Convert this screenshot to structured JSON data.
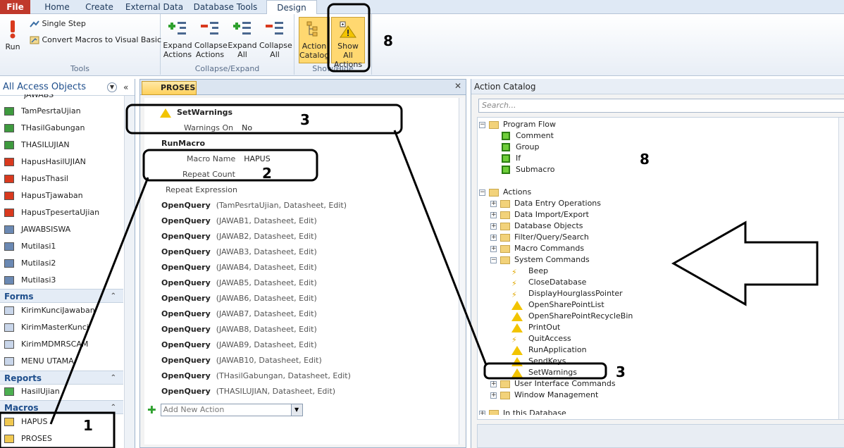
{
  "tabs": [
    "File",
    "Home",
    "Create",
    "External Data",
    "Database Tools",
    "Design"
  ],
  "ribbon": {
    "run": "Run",
    "single_step": "Single Step",
    "convert": "Convert Macros to Visual Basic",
    "tools_label": "Tools",
    "expand_actions": [
      "Expand",
      "Actions"
    ],
    "collapse_actions": [
      "Collapse",
      "Actions"
    ],
    "expand_all": [
      "Expand",
      "All"
    ],
    "collapse_all": [
      "Collapse",
      "All"
    ],
    "collapse_expand_label": "Collapse/Expand",
    "action_catalog": [
      "Action",
      "Catalog"
    ],
    "show_all_actions": [
      "Show All",
      "Actions"
    ],
    "show_hide_label": "Show/Hide"
  },
  "nav": {
    "title": "All Access Objects",
    "top_cut": "JAWABS",
    "queries": [
      "TamPesrtaUjian",
      "THasilGabungan",
      "THASILUJIAN",
      "HapusHasilUJIAN",
      "HapusThasil",
      "HapusTjawaban",
      "HapusTpesertaUjian",
      "JAWABSISWA",
      "Mutilasi1",
      "Mutilasi2",
      "Mutilasi3"
    ],
    "forms_label": "Forms",
    "forms": [
      "KirimKunciJawaban",
      "KirimMasterKunci",
      "KirimMDMRSCAM",
      "MENU UTAMA"
    ],
    "reports_label": "Reports",
    "reports": [
      "HasilUjian"
    ],
    "macros_label": "Macros",
    "macros": [
      "HAPUS",
      "PROSES"
    ]
  },
  "macro": {
    "tab": "PROSES",
    "setwarnings": "SetWarnings",
    "warnings_on_label": "Warnings On",
    "warnings_on_value": "No",
    "runmacro": "RunMacro",
    "macro_name_label": "Macro Name",
    "macro_name_value": "HAPUS",
    "repeat_count_label": "Repeat Count",
    "repeat_expression_label": "Repeat Expression",
    "openquery_label": "OpenQuery",
    "openqueries": [
      "(TamPesrtaUjian, Datasheet, Edit)",
      "(JAWAB1, Datasheet, Edit)",
      "(JAWAB2, Datasheet, Edit)",
      "(JAWAB3, Datasheet, Edit)",
      "(JAWAB4, Datasheet, Edit)",
      "(JAWAB5, Datasheet, Edit)",
      "(JAWAB6, Datasheet, Edit)",
      "(JAWAB7, Datasheet, Edit)",
      "(JAWAB8, Datasheet, Edit)",
      "(JAWAB9, Datasheet, Edit)",
      "(JAWAB10, Datasheet, Edit)",
      "(THasilGabungan, Datasheet, Edit)",
      "(THASILUJIAN, Datasheet, Edit)"
    ],
    "add_new_action": "Add New Action"
  },
  "catalog": {
    "title": "Action Catalog",
    "search_placeholder": "Search...",
    "program_flow": "Program Flow",
    "program_flow_items": [
      "Comment",
      "Group",
      "If",
      "Submacro"
    ],
    "actions": "Actions",
    "action_groups": [
      "Data Entry Operations",
      "Data Import/Export",
      "Database Objects",
      "Filter/Query/Search",
      "Macro Commands",
      "System Commands"
    ],
    "system_commands": [
      "Beep",
      "CloseDatabase",
      "DisplayHourglassPointer",
      "OpenSharePointList",
      "OpenSharePointRecycleBin",
      "PrintOut",
      "QuitAccess",
      "RunApplication",
      "SendKeys",
      "SetWarnings"
    ],
    "after_groups": [
      "User Interface Commands",
      "Window Management"
    ],
    "in_this_database": "In this Database"
  },
  "annotations": {
    "n1": "1",
    "n2": "2",
    "n3a": "3",
    "n3b": "3",
    "n8a": "8",
    "n8b": "8"
  }
}
